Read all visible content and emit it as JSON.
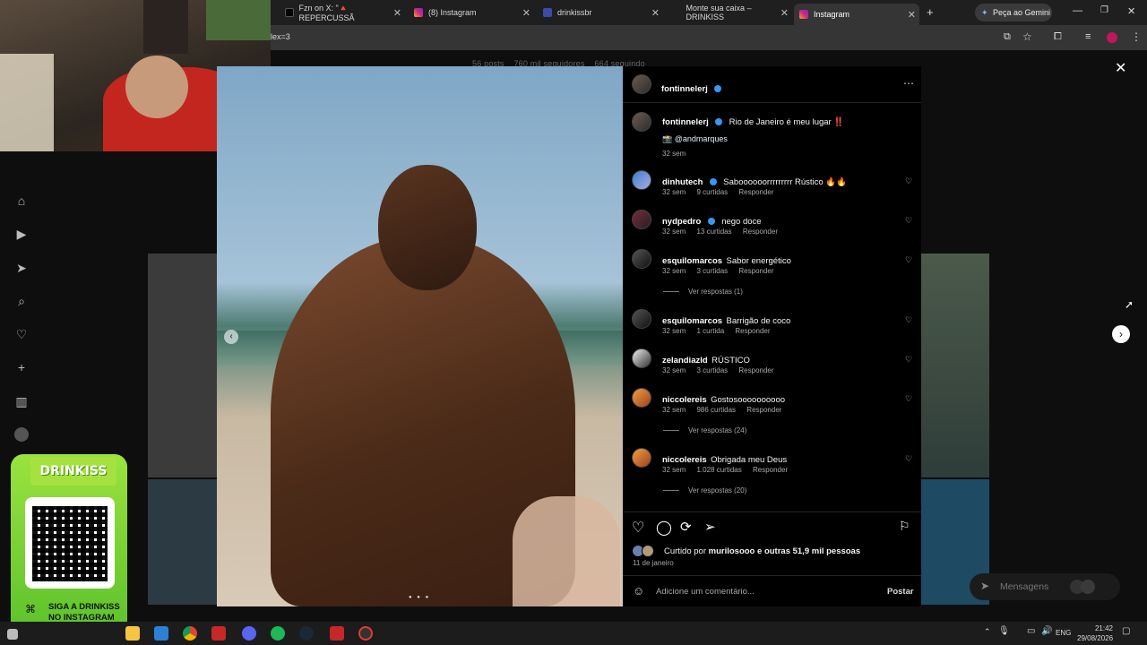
{
  "browser": {
    "tabs": [
      {
        "title": "Fzn on X: \"🔺 REPERCUSSÃ"
      },
      {
        "title": "(8) Instagram"
      },
      {
        "title": "drinkissbr"
      },
      {
        "title": "Monte sua caixa – DRINKISS"
      },
      {
        "title": "Instagram"
      }
    ],
    "new_tab": "+",
    "gemini_label": "Peça ao Gemini",
    "url_fragment": "lex=3"
  },
  "profile": {
    "posts": "56 posts",
    "followers_num": "760 mil",
    "followers_label": "seguidores",
    "following": "664 seguindo"
  },
  "post": {
    "author": "fontinnelerj",
    "caption_user": "fontinnelerj",
    "caption_text": "Rio de Janeiro é meu lugar ‼️",
    "caption_tag": "📸 @andmarques",
    "caption_time": "32 sem",
    "likes_prefix": "Curtido por",
    "likes_user": "murilosooo",
    "likes_suffix": "e outras 51,9 mil pessoas",
    "date": "11 de janeiro",
    "comment_placeholder": "Adicione um comentário...",
    "post_button": "Postar"
  },
  "comments": [
    {
      "user": "dinhutech",
      "verified": true,
      "text": "Saboooooorrrrrrrrr Rústico 🔥🔥",
      "time": "32 sem",
      "likes": "9 curtidas",
      "reply": "Responder"
    },
    {
      "user": "nydpedro",
      "verified": true,
      "text": "nego doce",
      "time": "32 sem",
      "likes": "13 curtidas",
      "reply": "Responder"
    },
    {
      "user": "esquilomarcos",
      "verified": false,
      "text": "Sabor energético",
      "time": "32 sem",
      "likes": "3 curtidas",
      "reply": "Responder",
      "view_replies": "Ver respostas (1)"
    },
    {
      "user": "esquilomarcos",
      "verified": false,
      "text": "Barrigão de coco",
      "time": "32 sem",
      "likes": "1 curtida",
      "reply": "Responder"
    },
    {
      "user": "zelandiazld",
      "verified": false,
      "text": "RÚSTICO",
      "time": "32 sem",
      "likes": "3 curtidas",
      "reply": "Responder"
    },
    {
      "user": "niccolereis",
      "verified": false,
      "text": "Gostosoooooooooo",
      "time": "32 sem",
      "likes": "986 curtidas",
      "reply": "Responder",
      "view_replies": "Ver respostas (24)"
    },
    {
      "user": "niccolereis",
      "verified": false,
      "text": "Obrigada meu Deus",
      "time": "32 sem",
      "likes": "1.028 curtidas",
      "reply": "Responder",
      "view_replies": "Ver respostas (20)"
    }
  ],
  "messages_label": "Mensagens",
  "promo": {
    "brand": "DRINKISS",
    "line1": "SIGA A DRINKISS",
    "line2": "NO INSTAGRAM"
  },
  "taskbar": {
    "lang": "ENG",
    "time": "21:42",
    "date": "29/08/2026"
  },
  "colors": {
    "accent": "#3897f0",
    "panel": "#000000",
    "promo_green": "#7ed03a"
  }
}
